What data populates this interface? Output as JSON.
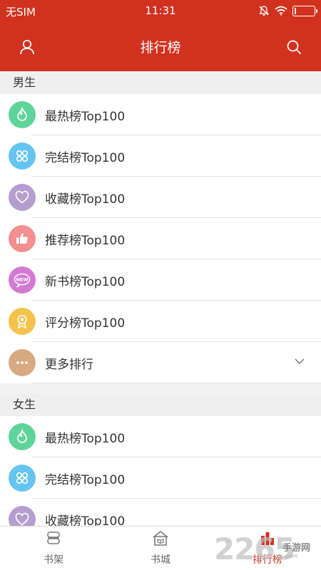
{
  "status_bar": {
    "carrier": "无SIM",
    "time": "11:31"
  },
  "header": {
    "title": "排行榜",
    "user_icon": "user-icon",
    "search_icon": "search-icon"
  },
  "sections": [
    {
      "title": "男生",
      "items": [
        {
          "label": "最热榜Top100",
          "icon": "flame-icon",
          "color": "#5fd49a"
        },
        {
          "label": "完结榜Top100",
          "icon": "grid-icon",
          "color": "#66c4f0"
        },
        {
          "label": "收藏榜Top100",
          "icon": "heart-icon",
          "color": "#b59ecf"
        },
        {
          "label": "推荐榜Top100",
          "icon": "thumb-up-icon",
          "color": "#f38f8f"
        },
        {
          "label": "新书榜Top100",
          "icon": "new-badge-icon",
          "color": "#d47ad3",
          "icon_text": "NEW"
        },
        {
          "label": "评分榜Top100",
          "icon": "medal-icon",
          "color": "#f4c24b"
        },
        {
          "label": "更多排行",
          "icon": "more-icon",
          "color": "#d9a982",
          "expandable": true
        }
      ]
    },
    {
      "title": "女生",
      "items": [
        {
          "label": "最热榜Top100",
          "icon": "flame-icon",
          "color": "#5fd49a"
        },
        {
          "label": "完结榜Top100",
          "icon": "grid-icon",
          "color": "#66c4f0"
        },
        {
          "label": "收藏榜Top100",
          "icon": "heart-icon",
          "color": "#b59ecf"
        }
      ]
    }
  ],
  "tabbar": {
    "tabs": [
      {
        "label": "书架",
        "icon": "bookshelf-icon",
        "active": false
      },
      {
        "label": "书城",
        "icon": "bookstore-icon",
        "active": false
      },
      {
        "label": "排行榜",
        "icon": "ranking-icon",
        "active": true
      }
    ]
  },
  "watermark": {
    "number": "2265",
    "site": "手游网",
    "url": ".com"
  },
  "colors": {
    "brand": "#d0321f",
    "background": "#f2f2f2",
    "active_tab": "#d0321f"
  }
}
